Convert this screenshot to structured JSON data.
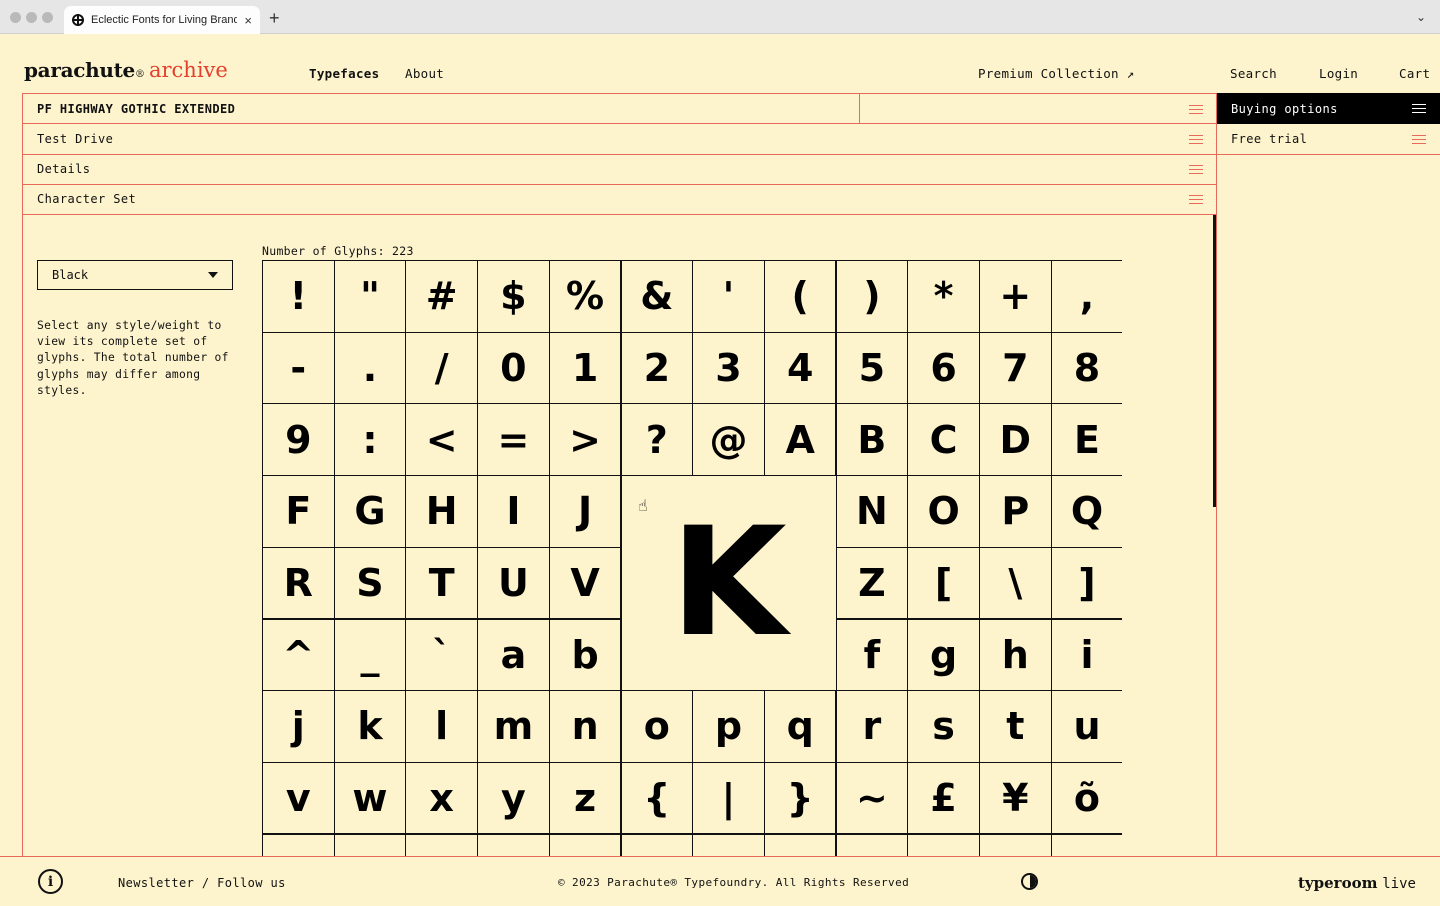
{
  "browser": {
    "tab_title": "Eclectic Fonts for Living Brands",
    "close_glyph": "×",
    "new_tab_glyph": "+",
    "dropdown_glyph": "⌄"
  },
  "header": {
    "logo_main": "parachute",
    "logo_reg": "®",
    "logo_sub": "archive",
    "nav": {
      "typefaces": "Typefaces",
      "about": "About",
      "premium": "Premium Collection ↗",
      "search": "Search",
      "login": "Login",
      "cart": "Cart"
    }
  },
  "panels": {
    "font_name": "PF HIGHWAY GOTHIC EXTENDED",
    "test_drive": "Test Drive",
    "details": "Details",
    "character_set": "Character Set",
    "buying_options": "Buying options",
    "free_trial": "Free trial"
  },
  "charset": {
    "selected_style": "Black",
    "help_text": "Select any style/weight to view its complete set of glyphs. The total number of glyphs may differ among styles.",
    "glyph_count_label": "Number of Glyphs: 223",
    "preview_glyph": "K",
    "glyphs": [
      "!",
      "\"",
      "#",
      "$",
      "%",
      "&",
      "'",
      "(",
      ")",
      "*",
      "+",
      ",",
      "-",
      ".",
      "/",
      "0",
      "1",
      "2",
      "3",
      "4",
      "5",
      "6",
      "7",
      "8",
      "9",
      ":",
      "<",
      "=",
      ">",
      "?",
      "@",
      "A",
      "B",
      "C",
      "D",
      "E",
      "F",
      "G",
      "H",
      "I",
      "J",
      "N",
      "O",
      "P",
      "Q",
      "R",
      "S",
      "T",
      "U",
      "V",
      "Z",
      "[",
      "\\",
      "]",
      "^",
      "_",
      "`",
      "a",
      "b",
      "f",
      "g",
      "h",
      "i",
      "j",
      "k",
      "l",
      "m",
      "n",
      "o",
      "p",
      "q",
      "r",
      "s",
      "t",
      "u",
      "v",
      "w",
      "x",
      "y",
      "z",
      "{",
      "|",
      "}",
      "~",
      "£",
      "¥",
      "õ"
    ]
  },
  "footer": {
    "info_glyph": "i",
    "newsletter": "Newsletter / Follow us",
    "copyright": "© 2023 Parachute® Typefoundry. All Rights Reserved",
    "typeroom_brand": "typeroom",
    "typeroom_live": "live"
  }
}
